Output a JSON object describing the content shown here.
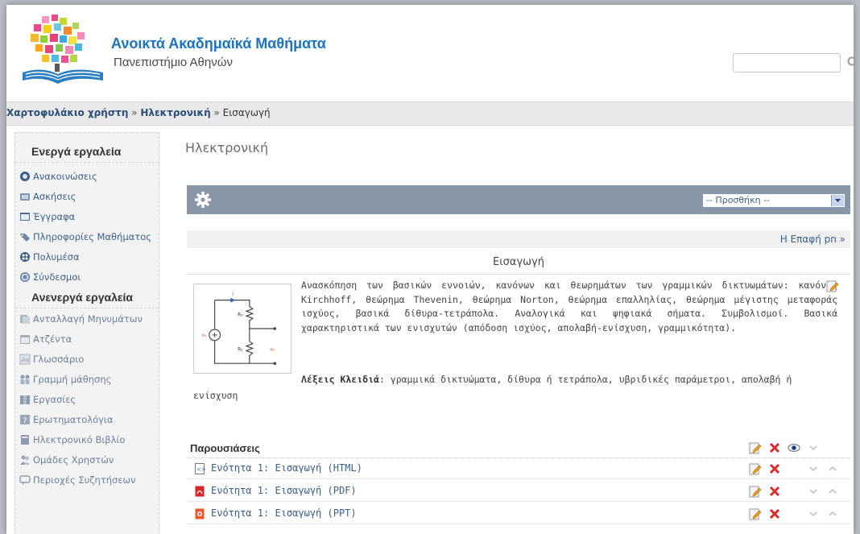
{
  "header": {
    "site_title": "Ανοικτά Ακαδημαϊκά Μαθήματα",
    "site_subtitle": "Πανεπιστήμιο Αθηνών",
    "search_placeholder": ""
  },
  "breadcrumb": {
    "items": [
      "Χαρτοφυλάκιο χρήστη",
      "Ηλεκτρονική",
      "Εισαγωγή"
    ],
    "separator": "»"
  },
  "sidebar": {
    "active_heading": "Ενεργά εργαλεία",
    "active_items": [
      {
        "label": "Ανακοινώσεις",
        "icon": "announcements-icon"
      },
      {
        "label": "Ασκήσεις",
        "icon": "exercises-icon"
      },
      {
        "label": "Έγγραφα",
        "icon": "documents-icon"
      },
      {
        "label": "Πληροφορίες Μαθήματος",
        "icon": "course-info-icon"
      },
      {
        "label": "Πολυμέσα",
        "icon": "multimedia-icon"
      },
      {
        "label": "Σύνδεσμοι",
        "icon": "links-icon"
      }
    ],
    "inactive_heading": "Ανενεργά εργαλεία",
    "inactive_items": [
      {
        "label": "Ανταλλαγή Μηνυμάτων",
        "icon": "messages-icon"
      },
      {
        "label": "Ατζέντα",
        "icon": "agenda-icon"
      },
      {
        "label": "Γλωσσάριο",
        "icon": "glossary-icon"
      },
      {
        "label": "Γραμμή μάθησης",
        "icon": "learning-path-icon"
      },
      {
        "label": "Εργασίες",
        "icon": "assignments-icon"
      },
      {
        "label": "Ερωτηματολόγια",
        "icon": "questionnaire-icon"
      },
      {
        "label": "Ηλεκτρονικό Βιβλίο",
        "icon": "ebook-icon"
      },
      {
        "label": "Ομάδες Χρηστών",
        "icon": "user-groups-icon"
      },
      {
        "label": "Περιοχές Συζητήσεων",
        "icon": "forums-icon"
      }
    ]
  },
  "main": {
    "course_title": "Ηλεκτρονική",
    "add_select_value": "-- Προσθήκη --",
    "next_unit_link": "Η Επαφή pn »",
    "section_title": "Εισαγωγή",
    "description": "Ανασκόπηση των βασικών εννοιών, κανόνων και θεωρημάτων των γραμμικών δικτυωμάτων: κανόνες Kirchhoff, θεώρημα Thevenin, θεώρημα Norton, θεώρημα επαλληλίας, θεώρημα μέγιστης μεταφοράς ισχύος, βασικά δίθυρα-τετράπολα. Αναλογικά και ψηφιακά σήματα. Συμβολισμοί. Βασικά χαρακτηριστικά των ενισχυτών (απόδοση ισχύος, απολαβή-ενίσχυση, γραμμικότητα).",
    "keywords_label": "Λέξεις Κλειδιά",
    "keywords_text": ": γραμμικά δικτυώματα, δίθυρα ή τετράπολα, υβριδικές παράμετροι, απολαβή ή",
    "keywords_tail": "ενίσχυση",
    "circuit_labels": {
      "r1": "R₁",
      "r2": "R₂",
      "vs": "vₛ",
      "vo": "vₒ",
      "i": "i"
    }
  },
  "resources": {
    "header": "Παρουσιάσεις",
    "rows": [
      {
        "label": "Ενότητα 1: Εισαγωγή (HTML)",
        "icon": "html-file-icon"
      },
      {
        "label": "Ενότητα 1: Εισαγωγή (PDF)",
        "icon": "pdf-file-icon"
      },
      {
        "label": "Ενότητα 1: Εισαγωγή (PPT)",
        "icon": "ppt-file-icon"
      }
    ]
  }
}
